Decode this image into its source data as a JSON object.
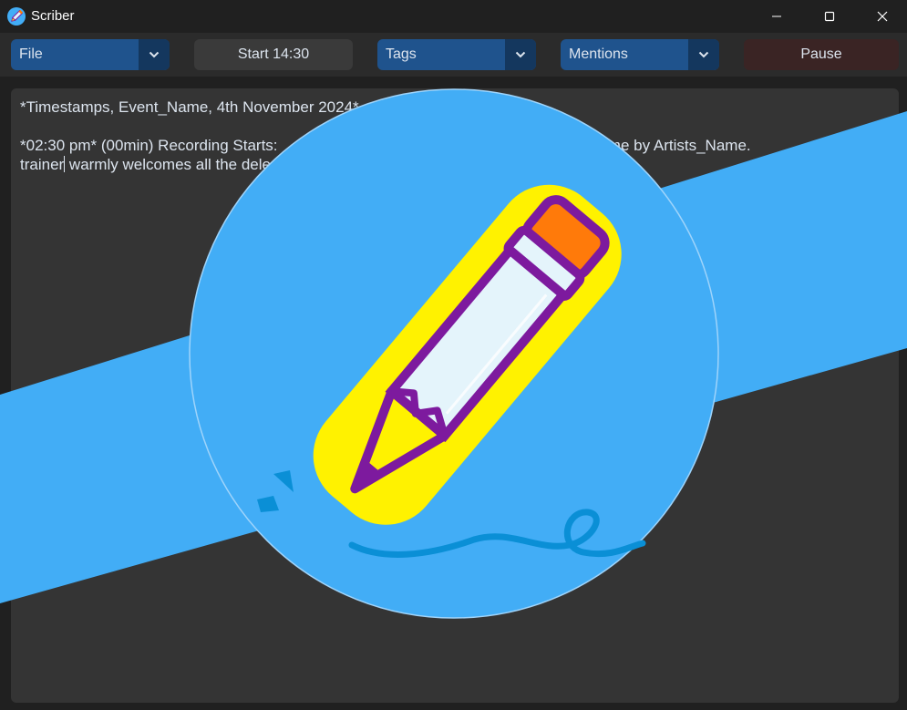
{
  "window": {
    "title": "Scriber"
  },
  "toolbar": {
    "file_label": "File",
    "start_label": "Start  14:30",
    "tags_label": "Tags",
    "mentions_label": "Mentions",
    "pause_label": "Pause"
  },
  "editor": {
    "line1": "*Timestamps, Event_Name, 4th November 2024*",
    "line2": "*02:30 pm* (00min) Recording Starts: ",
    "line2_tail": "ong_Name by Artists_Name. ",
    "line3_before_caret": "trainer",
    "line3_after_caret": " warmly welcomes all the dele"
  },
  "colors": {
    "splash_blue": "#42adf6",
    "pencil_yellow": "#fff200",
    "pencil_purple": "#7d1a9e",
    "eraser_orange": "#ff7a0a",
    "combo_blue": "#1f538d"
  },
  "icons": {
    "app": "pencil-icon",
    "minimize": "minimize-icon",
    "maximize": "maximize-icon",
    "close": "close-icon",
    "dropdown": "chevron-down-icon",
    "splash": "pencil-logo"
  }
}
